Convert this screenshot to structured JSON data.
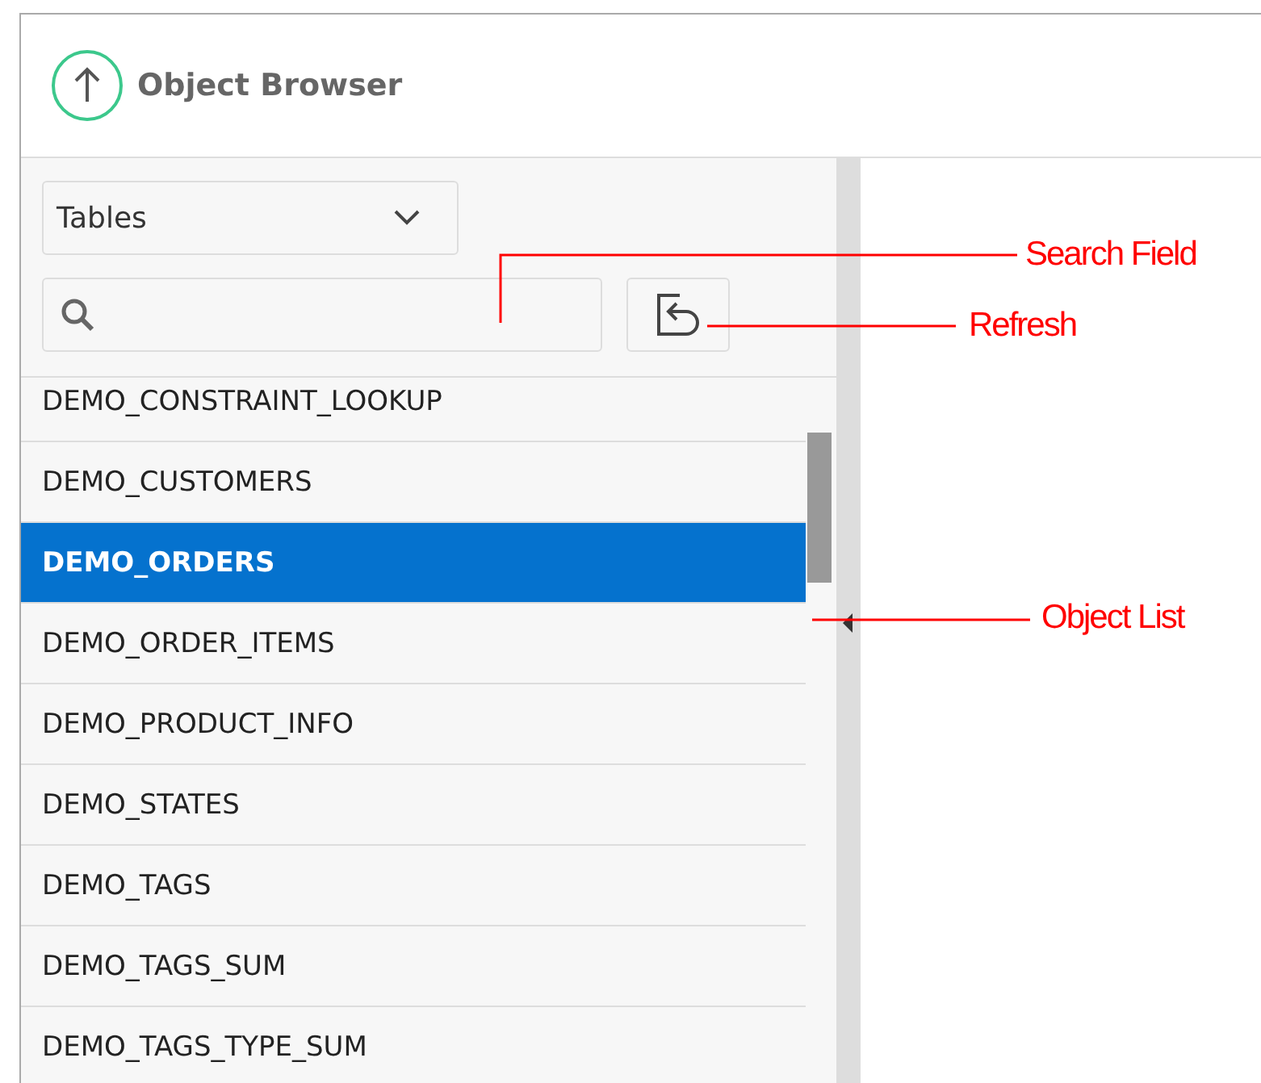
{
  "header": {
    "title": "Object Browser"
  },
  "object_type": {
    "value": "Tables"
  },
  "objects": [
    {
      "name": "DEMO_CONSTRAINT_LOOKUP",
      "selected": false
    },
    {
      "name": "DEMO_CUSTOMERS",
      "selected": false
    },
    {
      "name": "DEMO_ORDERS",
      "selected": true
    },
    {
      "name": "DEMO_ORDER_ITEMS",
      "selected": false
    },
    {
      "name": "DEMO_PRODUCT_INFO",
      "selected": false
    },
    {
      "name": "DEMO_STATES",
      "selected": false
    },
    {
      "name": "DEMO_TAGS",
      "selected": false
    },
    {
      "name": "DEMO_TAGS_SUM",
      "selected": false
    },
    {
      "name": "DEMO_TAGS_TYPE_SUM",
      "selected": false
    }
  ],
  "callouts": [
    {
      "label": "Search Field"
    },
    {
      "label": "Refresh"
    },
    {
      "label": "Object List"
    }
  ]
}
